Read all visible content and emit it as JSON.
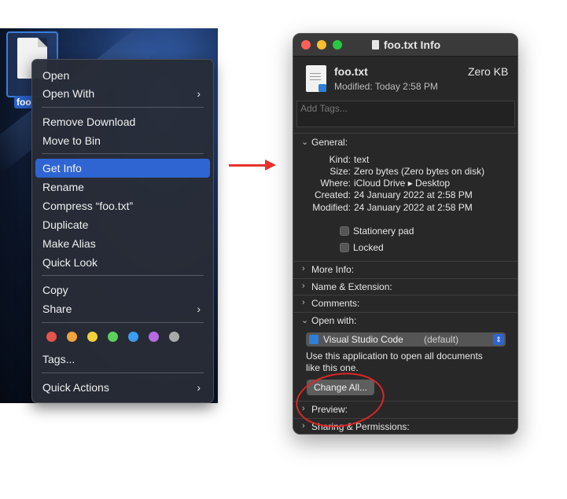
{
  "desktop": {
    "file_label": "foo"
  },
  "context_menu": {
    "items": [
      {
        "label": "Open"
      },
      {
        "label": "Open With",
        "submenu": true
      },
      {
        "label": "Remove Download"
      },
      {
        "label": "Move to Bin"
      },
      {
        "label": "Get Info",
        "selected": true
      },
      {
        "label": "Rename"
      },
      {
        "label": "Compress “foo.txt”"
      },
      {
        "label": "Duplicate"
      },
      {
        "label": "Make Alias"
      },
      {
        "label": "Quick Look"
      },
      {
        "label": "Copy"
      },
      {
        "label": "Share",
        "submenu": true
      },
      {
        "label": "Tags..."
      },
      {
        "label": "Quick Actions",
        "submenu": true
      }
    ],
    "tag_colors": [
      "#e5534b",
      "#f2a33a",
      "#f2d13c",
      "#5ad15a",
      "#3a9cf2",
      "#b56ae0",
      "#a9a9a9"
    ],
    "chevron": "›"
  },
  "info_window": {
    "title": "foo.txt Info",
    "traffic_lights": [
      "#fe5f57",
      "#febc2e",
      "#28c840"
    ],
    "file_name": "foo.txt",
    "size_header": "Zero KB",
    "modified_header": "Modified: Today 2:58 PM",
    "tags_placeholder": "Add Tags...",
    "general": {
      "header": "General:",
      "rows": [
        {
          "label": "Kind:",
          "value": "text"
        },
        {
          "label": "Size:",
          "value": "Zero bytes (Zero bytes on disk)"
        },
        {
          "label": "Where:",
          "value": "iCloud Drive ▸ Desktop"
        },
        {
          "label": "Created:",
          "value": "24 January 2022 at 2:58 PM"
        },
        {
          "label": "Modified:",
          "value": "24 January 2022 at 2:58 PM"
        }
      ],
      "stationery_pad": "Stationery pad",
      "locked": "Locked"
    },
    "sections": {
      "more_info": "More Info:",
      "name_extension": "Name & Extension:",
      "comments": "Comments:",
      "open_with": "Open with:",
      "preview": "Preview:",
      "sharing": "Sharing & Permissions:"
    },
    "open_with": {
      "app": "Visual Studio Code",
      "app_suffix": "(default)",
      "description": "Use this application to open all documents like this one.",
      "description_line1": "Use this application to open all documents",
      "description_line2": "like this one.",
      "change_all": "Change All..."
    },
    "disclosure_closed": "›",
    "disclosure_open": "⌄"
  }
}
